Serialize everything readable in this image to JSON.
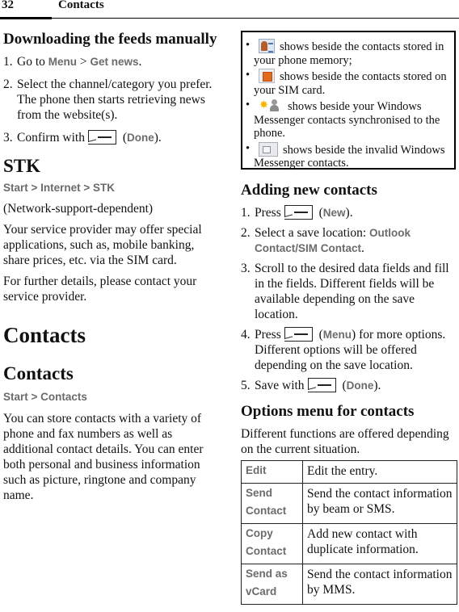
{
  "header": {
    "page_number": "32",
    "chapter": "Contacts"
  },
  "left": {
    "download": {
      "title": "Downloading the feeds manually",
      "steps": [
        {
          "num": "1.",
          "pre": "Go to ",
          "menu1": "Menu",
          "sep": " > ",
          "menu2": "Get news",
          "post": "."
        },
        {
          "num": "2.",
          "text": "Select the channel/category you prefer. The phone then starts retrieving news from the website(s)."
        },
        {
          "num": "3.",
          "pre": "Confirm with",
          "open": " (",
          "menu": "Done",
          "post": ")."
        }
      ]
    },
    "stk": {
      "title": "STK",
      "path": "Start > Internet > STK",
      "note": "(Network-support-dependent)",
      "para1": "Your service provider may offer special applications, such as, mobile banking, share prices, etc. via the SIM card.",
      "para2": "For further details, please contact your service provider."
    },
    "chapter_title": "Contacts",
    "contacts": {
      "title": "Contacts",
      "path": "Start > Contacts",
      "para": "You can store contacts with a variety of phone and fax numbers as well as additional contact details. You can enter both personal and business information such as picture, ringtone and company name."
    }
  },
  "right": {
    "icon_legend": [
      {
        "icon": "phone-memory-contact-icon",
        "text": "shows beside the contacts stored in your phone memory;"
      },
      {
        "icon": "sim-contact-icon",
        "text": "shows beside the contacts stored on your SIM card."
      },
      {
        "icon": "windows-messenger-contact-icon",
        "text": "shows beside your Windows Messenger contacts synchronised to the phone."
      },
      {
        "icon": "invalid-messenger-contact-icon",
        "text": "shows beside the invalid Windows Messenger contacts."
      }
    ],
    "adding": {
      "title": "Adding new contacts",
      "steps": [
        {
          "num": "1.",
          "pre": "Press",
          "open": " (",
          "menu": "New",
          "post": ")."
        },
        {
          "num": "2.",
          "pre": "Select a save location: ",
          "menu": "Outlook Contact/SIM Contact",
          "post": "."
        },
        {
          "num": "3.",
          "text": "Scroll to the desired data fields and fill in the fields. Different fields will be available depending on the save location."
        },
        {
          "num": "4.",
          "pre": "Press",
          "open": " (",
          "menu": "Menu",
          "post": ") for more options. Different options will be offered depending on the save location."
        },
        {
          "num": "5.",
          "pre": "Save with",
          "open": " (",
          "menu": "Done",
          "post": ")."
        }
      ]
    },
    "options": {
      "title": "Options menu for contacts",
      "intro": "Different functions are offered depending on the current situation.",
      "rows": [
        {
          "key": "Edit",
          "desc": "Edit the entry."
        },
        {
          "key": "Send Contact",
          "desc": "Send the contact information by beam or SMS."
        },
        {
          "key": "Copy Contact",
          "desc": "Add new contact with duplicate information."
        },
        {
          "key": "Send as vCard",
          "desc": "Send the contact information by MMS."
        }
      ]
    }
  }
}
